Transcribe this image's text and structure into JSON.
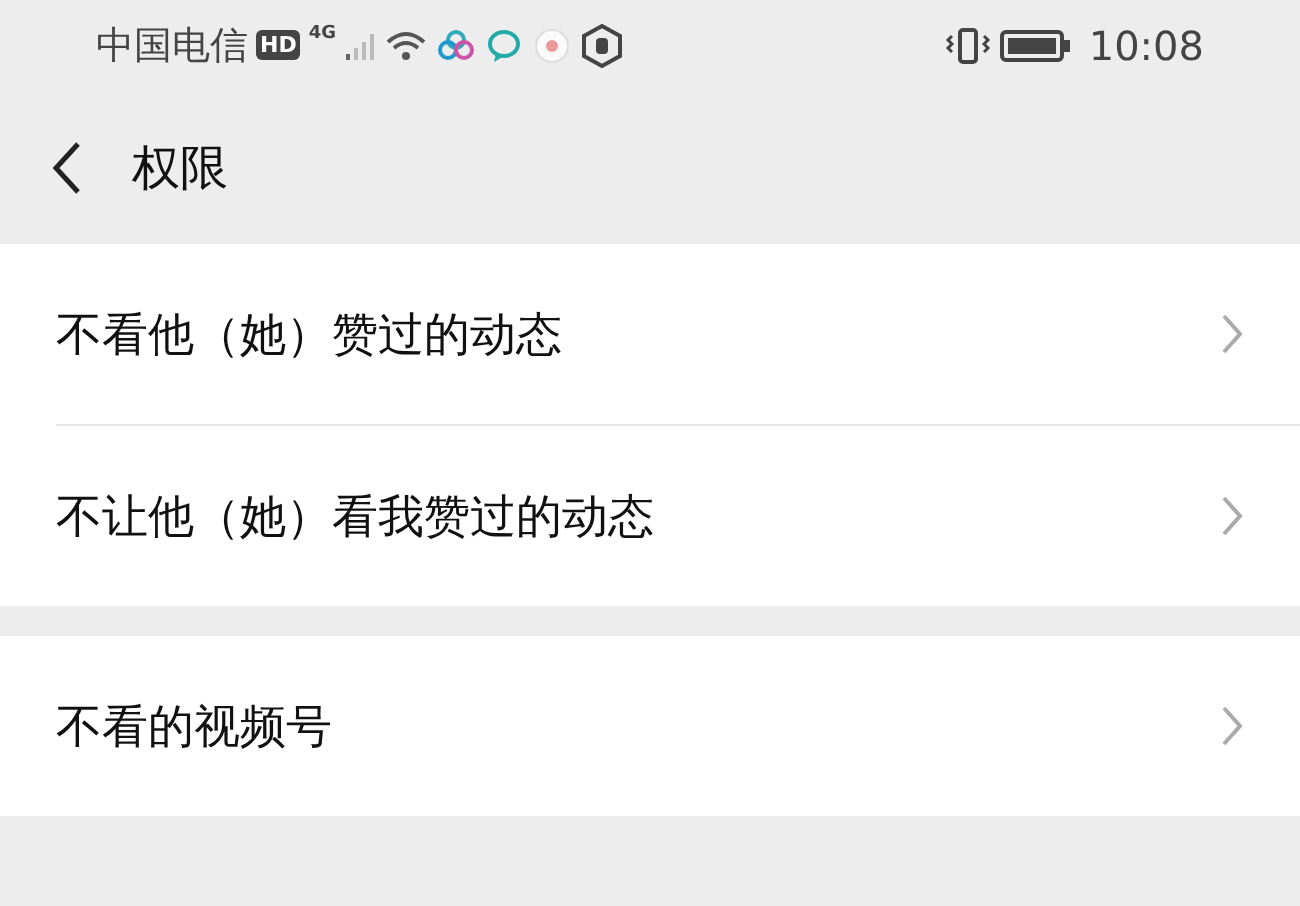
{
  "status_bar": {
    "carrier": "中国电信",
    "hd_badge": "HD",
    "network": "4G",
    "time": "10:08"
  },
  "header": {
    "title": "权限"
  },
  "sections": [
    {
      "items": [
        {
          "label": "不看他（她）赞过的动态"
        },
        {
          "label": "不让他（她）看我赞过的动态"
        }
      ]
    },
    {
      "items": [
        {
          "label": "不看的视频号"
        }
      ]
    }
  ]
}
